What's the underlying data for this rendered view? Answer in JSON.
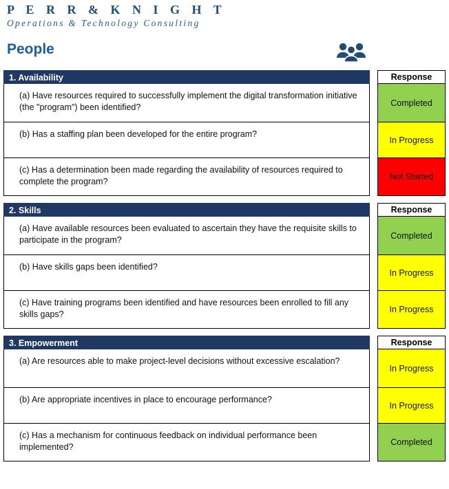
{
  "brand": {
    "name": "P E R R & K N I G H T",
    "tagline": "Operations & Technology Consulting",
    "color": "#1F4E79"
  },
  "header": {
    "page_title": "People",
    "title_color": "#1F5C9E",
    "icon": "people-group-icon"
  },
  "response_column_header": "Response",
  "status_colors": {
    "Completed": "#92D050",
    "In Progress": "#FFFF00",
    "Not Started": "#FF0000"
  },
  "sections": [
    {
      "title": "1. Availability",
      "rows": [
        {
          "question": "(a) Have resources required to successfully implement the digital transformation initiative (the \"program\") been identified?",
          "response": "Completed",
          "status": "completed"
        },
        {
          "question": "(b) Has a staffing plan been developed for the entire program?",
          "response": "In Progress",
          "status": "inprogress"
        },
        {
          "question": "(c) Has a determination been made regarding the availability of resources required to complete the program?",
          "response": "Not Started",
          "status": "notstarted"
        }
      ]
    },
    {
      "title": "2. Skills",
      "rows": [
        {
          "question": "(a) Have available resources been evaluated to ascertain they have the requisite skills to participate in the program?",
          "response": "Completed",
          "status": "completed"
        },
        {
          "question": "(b) Have skills gaps been identified?",
          "response": "In Progress",
          "status": "inprogress"
        },
        {
          "question": "(c) Have training programs been identified and have resources been enrolled to fill any skills gaps?",
          "response": "In Progress",
          "status": "inprogress"
        }
      ]
    },
    {
      "title": "3. Empowerment",
      "rows": [
        {
          "question": "(a) Are resources able to make project-level decisions without excessive escalation?",
          "response": "In Progress",
          "status": "inprogress"
        },
        {
          "question": "(b) Are appropriate incentives in place to encourage performance?",
          "response": "In Progress",
          "status": "inprogress"
        },
        {
          "question": "(c) Has a mechanism for continuous feedback on individual performance been implemented?",
          "response": "Completed",
          "status": "completed"
        }
      ]
    }
  ]
}
